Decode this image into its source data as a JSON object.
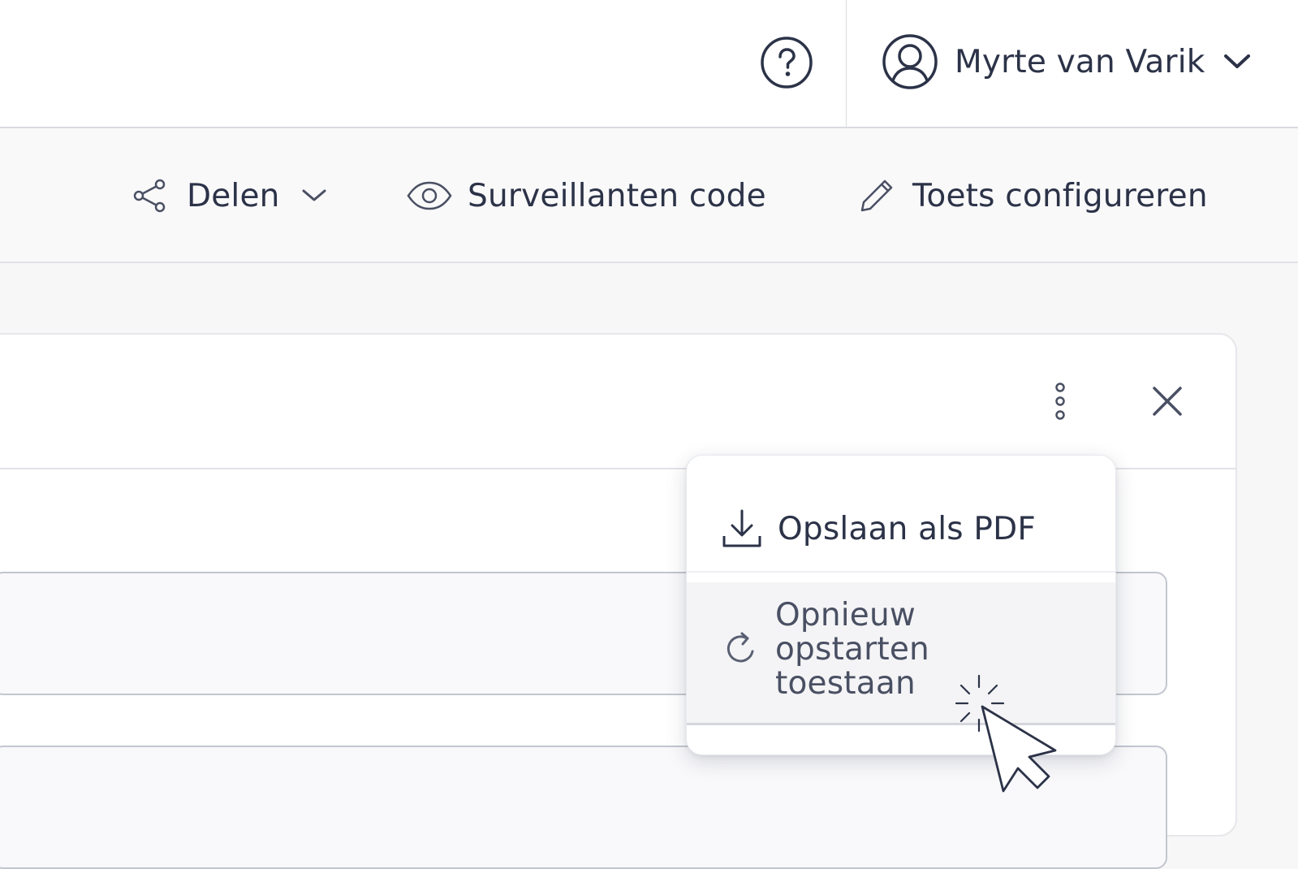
{
  "header": {
    "help_icon": "question-circle-icon",
    "user": {
      "name": "Myrte van Varik",
      "avatar_icon": "user-circle-icon",
      "chevron_icon": "chevron-down-icon"
    }
  },
  "toolbar": {
    "share": {
      "label": "Delen",
      "icon": "share-icon",
      "chevron_icon": "chevron-down-icon"
    },
    "proctor_code": {
      "label": "Surveillanten code",
      "icon": "eye-icon"
    },
    "configure": {
      "label": "Toets configureren",
      "icon": "pencil-icon"
    }
  },
  "panel": {
    "more_icon": "more-vertical-icon",
    "close_icon": "close-icon"
  },
  "dropdown": {
    "items": [
      {
        "label": "Opslaan als PDF",
        "icon": "download-icon"
      },
      {
        "label": "Opnieuw opstarten toestaan",
        "icon": "refresh-icon",
        "state": "hovered"
      }
    ]
  },
  "colors": {
    "text": "#2c3348",
    "background": "#f7f7f8",
    "border": "#dadbe0",
    "hover": "#f4f4f6"
  }
}
